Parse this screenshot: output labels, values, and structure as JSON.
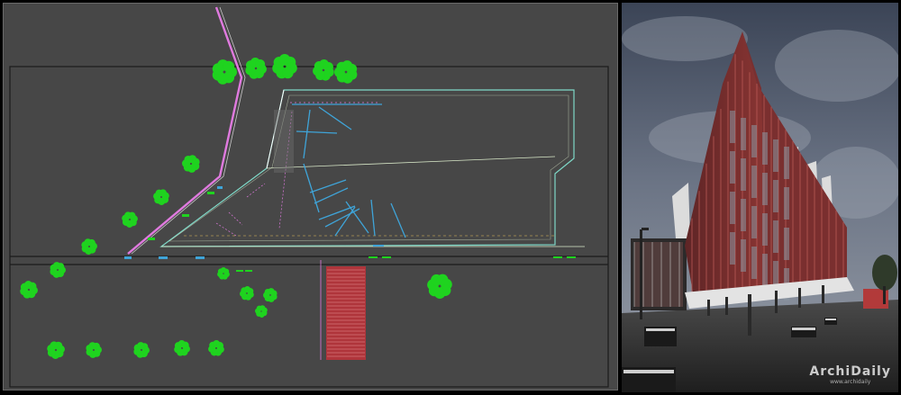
{
  "panels": {
    "left": {
      "name": "site-plan-drawing"
    },
    "right": {
      "name": "building-render"
    }
  },
  "colors": {
    "plan_background": "#474747",
    "plan_outline": "#1a1a1a",
    "building_outline": "#7fd9c8",
    "tree_green": "#1fd31f",
    "path_pink": "#e07adf",
    "accent_blue": "#3fa4d8",
    "stair_red": "#c2333a",
    "facade_red": "#8a3533",
    "sky": "#4c5667"
  },
  "watermark": {
    "logo_text": "ArchiDaily",
    "sub_text": "www.archidaily"
  }
}
